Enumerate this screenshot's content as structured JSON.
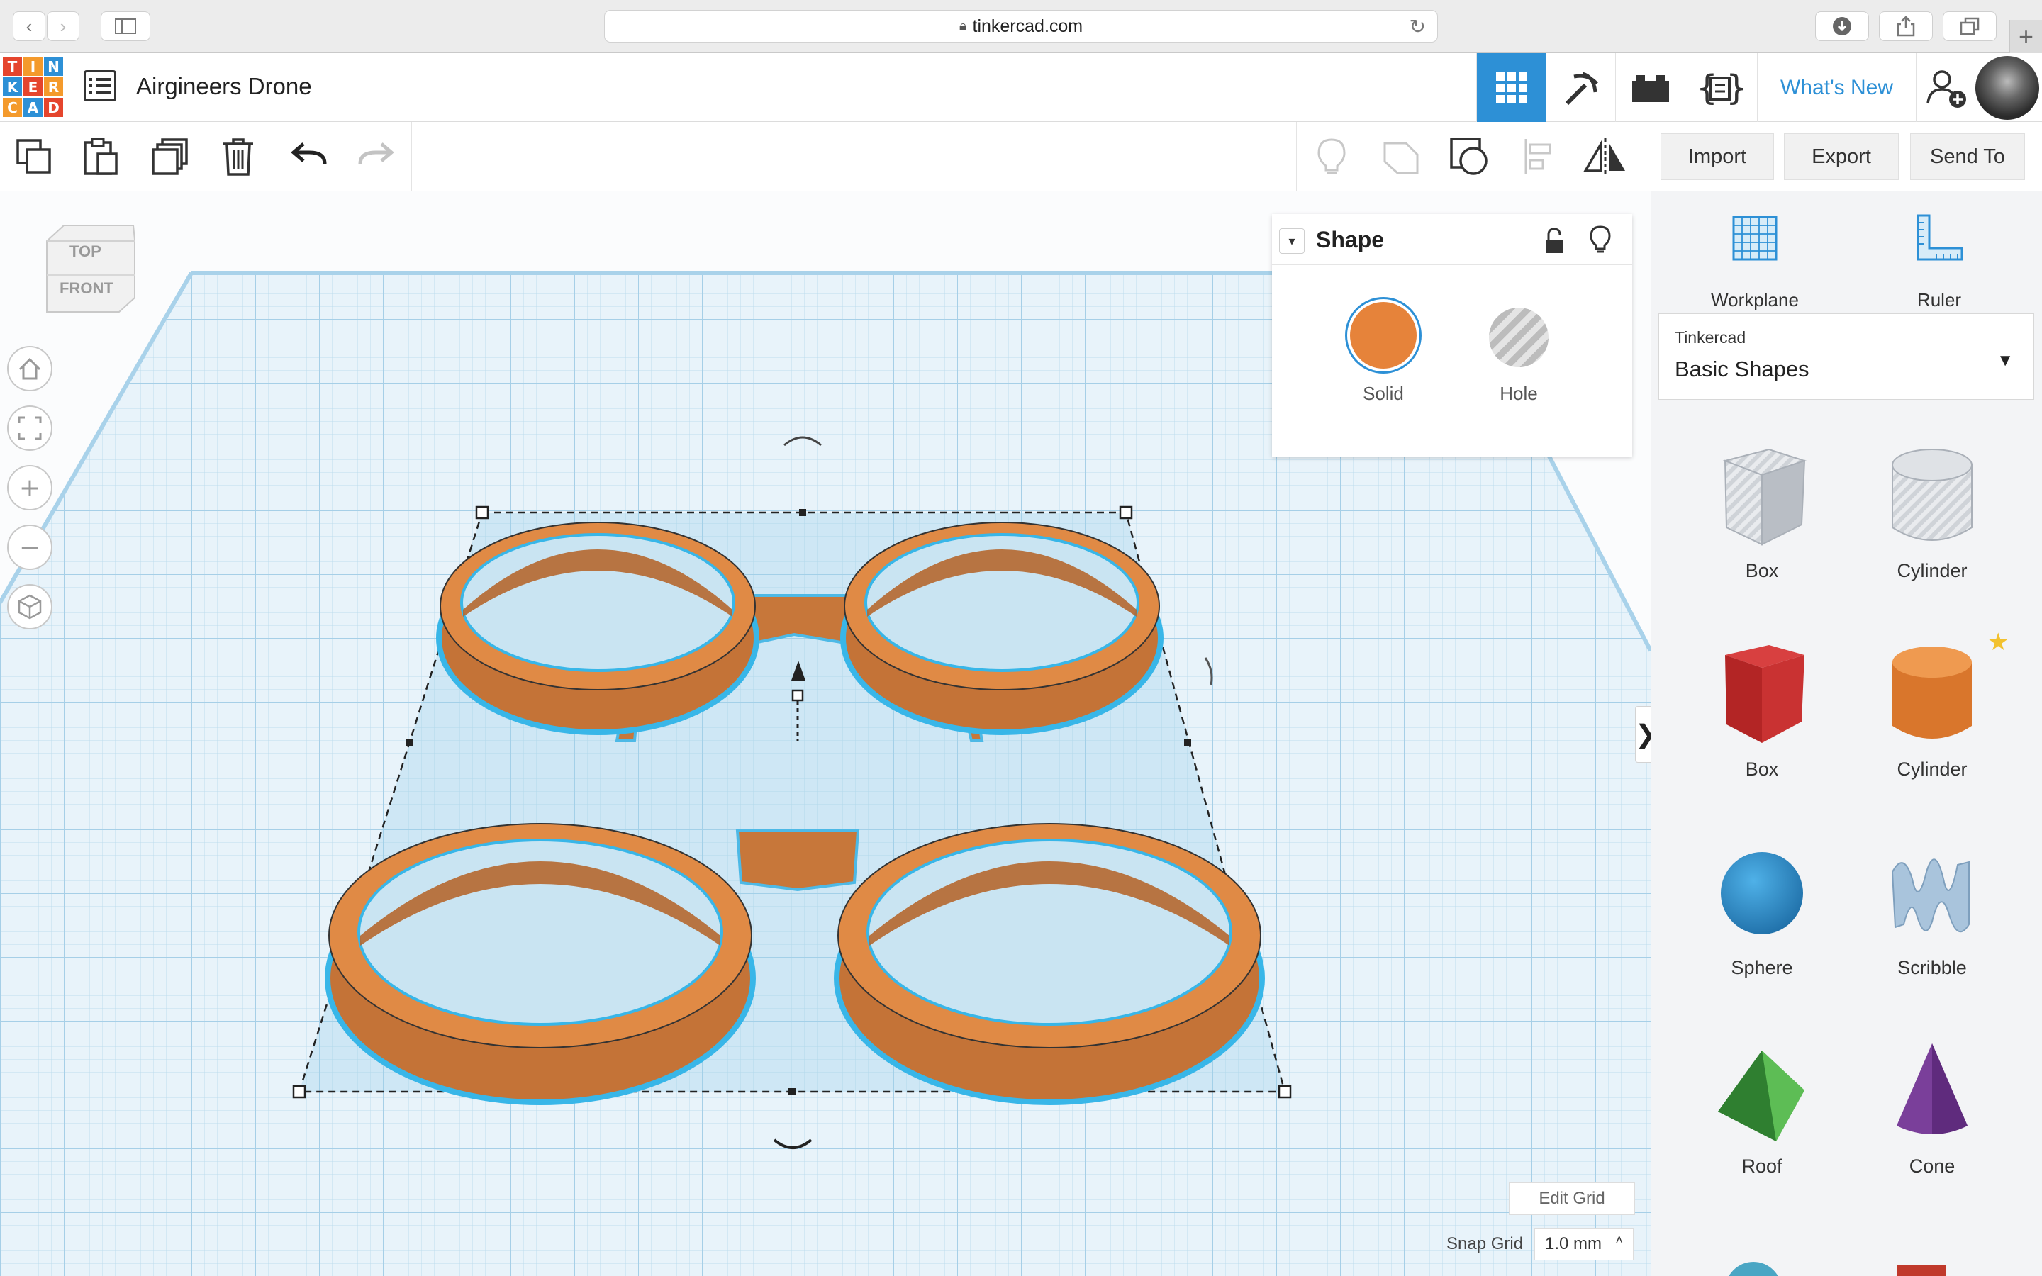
{
  "browser": {
    "url": "tinkercad.com"
  },
  "app": {
    "logo_letters": [
      "T",
      "I",
      "N",
      "K",
      "E",
      "R",
      "C",
      "A",
      "D"
    ],
    "logo_colors": [
      "#e5452d",
      "#f49a2c",
      "#2d90d6",
      "#2d90d6",
      "#e5452d",
      "#f49a2c",
      "#f49a2c",
      "#2d90d6",
      "#e5452d"
    ],
    "document_title": "Airgineers Drone",
    "whats_new": "What's New",
    "accent": "#2d90d6",
    "active_view": "3d-design"
  },
  "toolbar": {
    "import": "Import",
    "export": "Export",
    "send_to": "Send To"
  },
  "viewcube": {
    "top": "TOP",
    "front": "FRONT"
  },
  "inspector": {
    "title": "Shape",
    "solid": "Solid",
    "hole": "Hole",
    "solid_color": "#e6833a"
  },
  "panel": {
    "workplane": "Workplane",
    "ruler": "Ruler",
    "library_owner": "Tinkercad",
    "library_name": "Basic Shapes",
    "shapes": [
      {
        "label": "Box",
        "icon": "box-hole-icon"
      },
      {
        "label": "Cylinder",
        "icon": "cylinder-hole-icon"
      },
      {
        "label": "Box",
        "icon": "box-red-icon"
      },
      {
        "label": "Cylinder",
        "icon": "cylinder-orange-icon"
      },
      {
        "label": "Sphere",
        "icon": "sphere-blue-icon"
      },
      {
        "label": "Scribble",
        "icon": "scribble-icon"
      },
      {
        "label": "Roof",
        "icon": "roof-green-icon"
      },
      {
        "label": "Cone",
        "icon": "cone-purple-icon"
      }
    ]
  },
  "grid": {
    "edit_grid": "Edit Grid",
    "snap_label": "Snap Grid",
    "snap_value": "1.0 mm"
  },
  "model": {
    "color": "#e08a45",
    "selection_outline": "#38b6e8"
  }
}
